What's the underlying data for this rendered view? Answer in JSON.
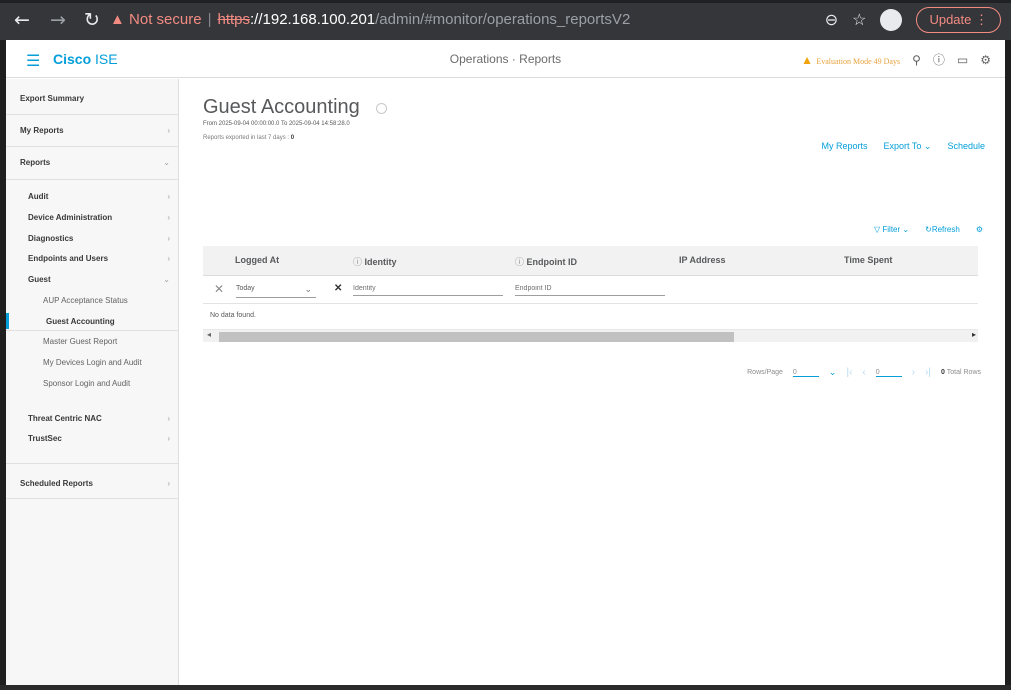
{
  "browser": {
    "warning": "Not secure",
    "url_scheme": "https",
    "url_host": "://192.168.100.201",
    "url_path": "/admin/#monitor/operations_reportsV2",
    "update_label": "Update"
  },
  "header": {
    "brand_bold": "Cisco",
    "brand_rest": " ISE",
    "center": "Operations · Reports",
    "eval_label": "Evaluation Mode 49 Days"
  },
  "sidebar": {
    "export_summary": "Export Summary",
    "my_reports": "My Reports",
    "reports": "Reports",
    "items": [
      {
        "label": "Audit"
      },
      {
        "label": "Device Administration"
      },
      {
        "label": "Diagnostics"
      },
      {
        "label": "Endpoints and Users"
      },
      {
        "label": "Guest"
      }
    ],
    "guest_sub": [
      {
        "label": "AUP Acceptance Status"
      },
      {
        "label": "Guest Accounting"
      },
      {
        "label": "Master Guest Report"
      },
      {
        "label": "My Devices Login and Audit"
      },
      {
        "label": "Sponsor Login and Audit"
      }
    ],
    "threat": "Threat Centric NAC",
    "trustsec": "TrustSec",
    "scheduled": "Scheduled Reports"
  },
  "main": {
    "title": "Guest Accounting",
    "range": "From 2025-09-04 00:00:00.0 To 2025-09-04 14:58:28.0",
    "exported_label": "Reports exported in last 7 days",
    "exported_count": "0",
    "actions": {
      "my_reports": "My Reports",
      "export_to": "Export To",
      "schedule": "Schedule"
    },
    "toolbar": {
      "filter": "Filter",
      "refresh": "Refresh"
    }
  },
  "table": {
    "columns": [
      "Logged At",
      "Identity",
      "Endpoint ID",
      "IP Address",
      "Time Spent"
    ],
    "filter_time": "Today",
    "identity_placeholder": "Identity",
    "endpoint_placeholder": "Endpoint ID",
    "empty": "No data found."
  },
  "pager": {
    "rows_label": "Rows/Page",
    "rows_value": "0",
    "page_value": "0",
    "total_count": "0",
    "total_label": "Total Rows"
  }
}
